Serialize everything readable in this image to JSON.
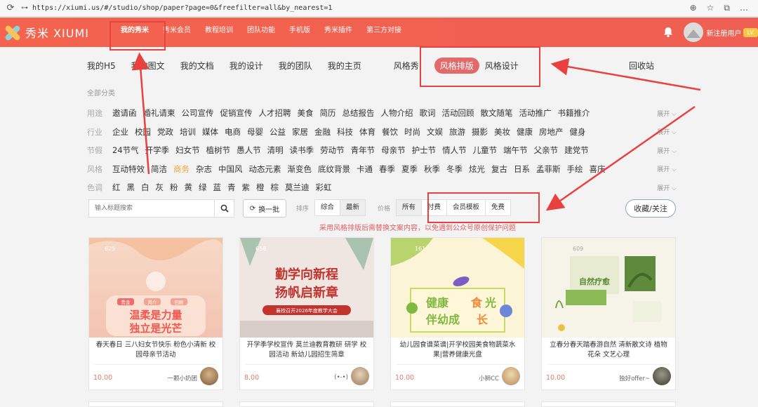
{
  "browser": {
    "url": "https://xiumi.us/#/studio/shop/paper?page=0&freefilter=all&by_nearest=1"
  },
  "brand": {
    "name": "秀米 XIUMI",
    "accent": "#ef5f53"
  },
  "topnav": [
    {
      "label": "我的秀米"
    },
    {
      "label": "秀米会员"
    },
    {
      "label": "教程培训"
    },
    {
      "label": "团队功能"
    },
    {
      "label": "手机版"
    },
    {
      "label": "秀米插件"
    },
    {
      "label": "第三方对接"
    }
  ],
  "user": {
    "name": "新注册用户",
    "level": "LV."
  },
  "subnav": {
    "left": [
      "我的H5",
      "我的图文",
      "我的文档",
      "我的设计",
      "我的团队",
      "我的主页"
    ],
    "mid": [
      "风格秀",
      "风格排版",
      "风格设计"
    ],
    "active": "风格排版",
    "right": "回收站"
  },
  "categories": {
    "heading": "全部分类",
    "rows": [
      {
        "label": "用途",
        "items": [
          "邀请函",
          "婚礼请柬",
          "公司宣传",
          "促销宣传",
          "人才招聘",
          "美食",
          "简历",
          "总结报告",
          "人物介绍",
          "歌词",
          "活动回顾",
          "散文随笔",
          "活动推广",
          "书籍推介"
        ],
        "more": "展开"
      },
      {
        "label": "行业",
        "items": [
          "企业",
          "校园",
          "党政",
          "培训",
          "媒体",
          "电商",
          "母婴",
          "公益",
          "家居",
          "金融",
          "科技",
          "体育",
          "餐饮",
          "时尚",
          "文娱",
          "旅游",
          "摄影",
          "美妆",
          "健康",
          "房地产",
          "健身"
        ],
        "more": "展开"
      },
      {
        "label": "节假",
        "items": [
          "24节气",
          "开学季",
          "妇女节",
          "植树节",
          "愚人节",
          "清明",
          "读书季",
          "劳动节",
          "青年节",
          "母亲节",
          "护士节",
          "情人节",
          "儿童节",
          "端午节",
          "父亲节",
          "建党节"
        ],
        "more": "展开"
      },
      {
        "label": "风格",
        "items": [
          "互动特效",
          "简洁",
          "商务",
          "杂志",
          "中国风",
          "动态元素",
          "渐变色",
          "底纹背景",
          "卡通",
          "春季",
          "夏季",
          "秋季",
          "冬季",
          "炫光",
          "复古",
          "日系",
          "孟菲斯",
          "手绘",
          "喜庆"
        ],
        "highlight": "商务",
        "more": "展开"
      },
      {
        "label": "色调",
        "items": [
          "红",
          "黑",
          "白",
          "灰",
          "粉",
          "黄",
          "绿",
          "蓝",
          "青",
          "紫",
          "橙",
          "棕",
          "莫兰迪",
          "彩虹"
        ],
        "more": "展开"
      }
    ]
  },
  "toolbar": {
    "search_placeholder": "输入标题搜索",
    "swap_label": "换一批",
    "sort_label": "排序",
    "sort_options": [
      "综合",
      "最新"
    ],
    "sort_selected": "最新",
    "price_label": "价格",
    "price_options": [
      "所有",
      "付费",
      "会员模板",
      "免费"
    ],
    "price_selected": "所有",
    "follow_label": "收藏/关注"
  },
  "notice": "采用风格排版后需替换文案内容，以免遇到公众号原创保护问题",
  "cards": [
    {
      "title": "春天春日 三八妇女节快乐 粉色小清新 校园母亲节活动",
      "price": "10.00",
      "author": "一颗小奶团",
      "thumb_text": [
        "温柔是力量",
        "独立是光芒"
      ],
      "tags": [
        "贵金",
        "简介",
        "回顾"
      ],
      "count": "625"
    },
    {
      "title": "开学季学校宣传 莫兰迪教育教研 研学 校园活动 新幼儿园招生简章",
      "price": "8.00",
      "author": "(•-•)",
      "thumb_text": [
        "勤学向新程",
        "扬帆启新章"
      ],
      "banner": "襄校召开2026年度教学大会",
      "count": "658"
    },
    {
      "title": "幼儿园食谱菜谱|开学校园美食物蔬菜水果|营养健康光盘",
      "price": "10.00",
      "author": "小狮CC",
      "thumb_text": [
        "健康",
        "食",
        "光",
        "伴幼成",
        "长"
      ],
      "count": "161"
    },
    {
      "title": "立春分春天踏春游自然 清新散文诗 植物花朵 文艺心理",
      "price": "10.00",
      "author": "独好offer~",
      "thumb_text": [
        "自然疗愈"
      ],
      "count": "609"
    }
  ]
}
